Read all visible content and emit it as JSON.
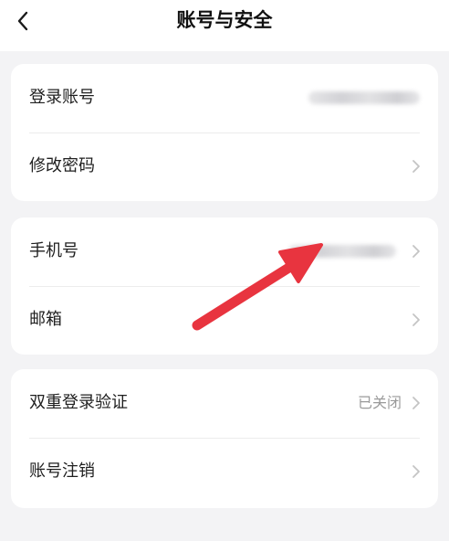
{
  "header": {
    "title": "账号与安全",
    "back_icon": "chevron-left-icon"
  },
  "groups": [
    {
      "items": [
        {
          "label": "登录账号",
          "value": "",
          "value_blurred": true,
          "has_chevron": false
        },
        {
          "label": "修改密码",
          "value": "",
          "has_chevron": true
        }
      ]
    },
    {
      "items": [
        {
          "label": "手机号",
          "value": "",
          "value_blurred": true,
          "has_chevron": true
        },
        {
          "label": "邮箱",
          "value": "",
          "has_chevron": true
        }
      ]
    },
    {
      "items": [
        {
          "label": "双重登录验证",
          "value": "已关闭",
          "has_chevron": true
        },
        {
          "label": "账号注销",
          "value": "",
          "has_chevron": true
        }
      ]
    }
  ],
  "annotation": {
    "icon": "red-arrow-icon",
    "color": "#e8343f"
  },
  "colors": {
    "background": "#f3f3f5",
    "card": "#ffffff",
    "secondary_text": "#9a9a9a",
    "chevron": "#c4c4c4"
  }
}
